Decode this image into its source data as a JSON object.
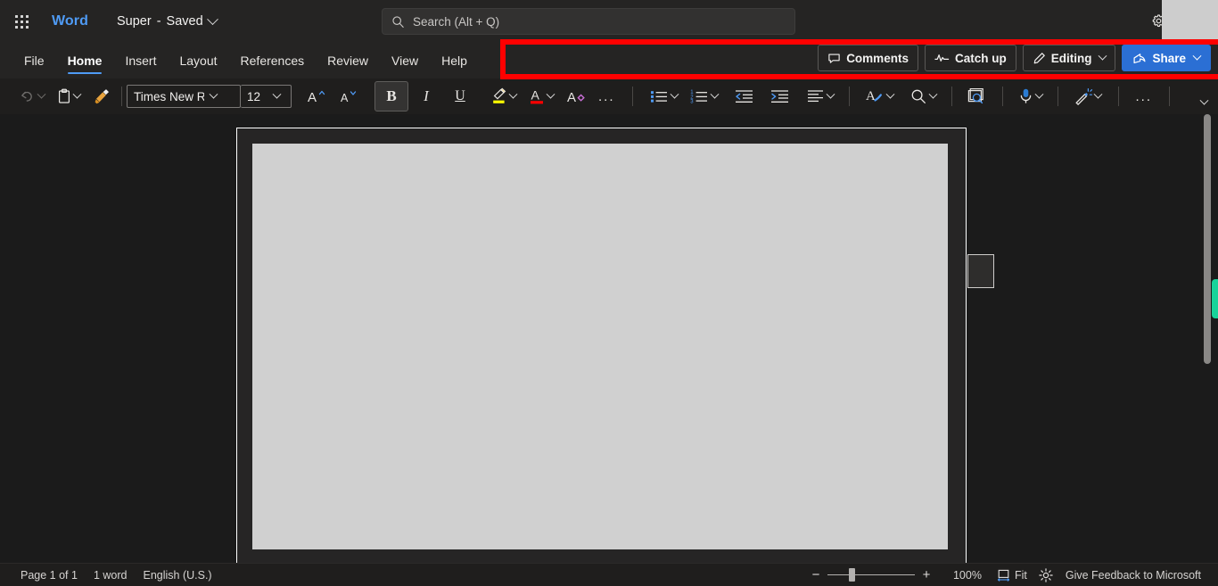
{
  "titlebar": {
    "app_launcher": "app-launcher",
    "brand": "Word",
    "document_name": "Super",
    "separator": "-",
    "save_state": "Saved",
    "settings_icon": "gear-icon"
  },
  "search": {
    "placeholder": "Search (Alt + Q)",
    "value": ""
  },
  "tabs": [
    {
      "label": "File",
      "active": false
    },
    {
      "label": "Home",
      "active": true
    },
    {
      "label": "Insert",
      "active": false
    },
    {
      "label": "Layout",
      "active": false
    },
    {
      "label": "References",
      "active": false
    },
    {
      "label": "Review",
      "active": false
    },
    {
      "label": "View",
      "active": false
    },
    {
      "label": "Help",
      "active": false
    }
  ],
  "actions": {
    "comments": "Comments",
    "catch_up": "Catch up",
    "editing": "Editing",
    "share": "Share"
  },
  "annotation": {
    "color": "#ff0000",
    "shape": "rectangle-highlight"
  },
  "toolbar": {
    "undo": "undo-arrow",
    "paste": "clipboard",
    "format_painter": "format-painter",
    "font_name": "Times New Ro...",
    "font_size": "12",
    "grow_font": "A",
    "shrink_font": "A",
    "bold": "B",
    "bold_active": true,
    "italic": "I",
    "underline": "U",
    "highlight_color": "#ffff00",
    "font_color": "#ff0000",
    "clear_format": "A",
    "more_font": "...",
    "bullets": "bullet-list",
    "numbering": "numbered-list",
    "decrease_indent": "decrease-indent",
    "increase_indent": "increase-indent",
    "align": "align-left",
    "styles": "styles",
    "find": "find",
    "editor": "editor",
    "dictate": "dictate",
    "designer": "designer",
    "more_options": "...",
    "collapse_ribbon": "collapse-ribbon"
  },
  "document": {
    "page_background": "#d0d0d0",
    "comment_anchor": "comment-anchor-box"
  },
  "statusbar": {
    "page_info": "Page 1 of 1",
    "word_count": "1 word",
    "language": "English (U.S.)",
    "zoom_out": "−",
    "zoom_in": "+",
    "zoom_level": "100%",
    "fit": "Fit",
    "focus_mode": "focus-mode-icon",
    "feedback": "Give Feedback to Microsoft"
  },
  "scrollbar": {
    "accent_color": "#19d39a"
  }
}
